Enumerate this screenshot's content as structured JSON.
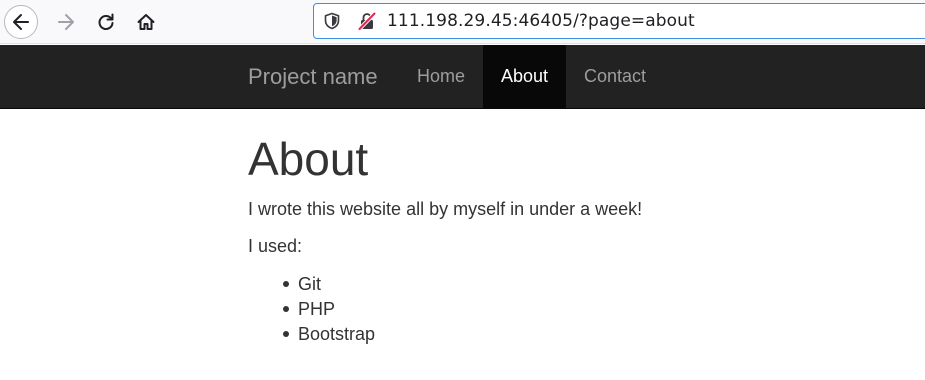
{
  "browser": {
    "url": "111.198.29.45:46405/?page=about",
    "icons": {
      "back": "arrow-left-icon",
      "forward": "arrow-right-icon",
      "reload": "reload-icon",
      "home": "home-icon",
      "tracking": "shield-icon",
      "security": "insecure-lock-icon"
    }
  },
  "navbar": {
    "brand": "Project name",
    "links": [
      {
        "label": "Home",
        "active": false
      },
      {
        "label": "About",
        "active": true
      },
      {
        "label": "Contact",
        "active": false
      }
    ]
  },
  "main": {
    "title": "About",
    "intro": "I wrote this website all by myself in under a week!",
    "used_label": "I used:",
    "tools": [
      "Git",
      "PHP",
      "Bootstrap"
    ]
  },
  "colors": {
    "navbar_bg": "#222222",
    "navbar_active_bg": "#080808",
    "navbar_link": "#9d9d9d",
    "url_focus_border": "#3d8fe0",
    "text": "#333333"
  }
}
